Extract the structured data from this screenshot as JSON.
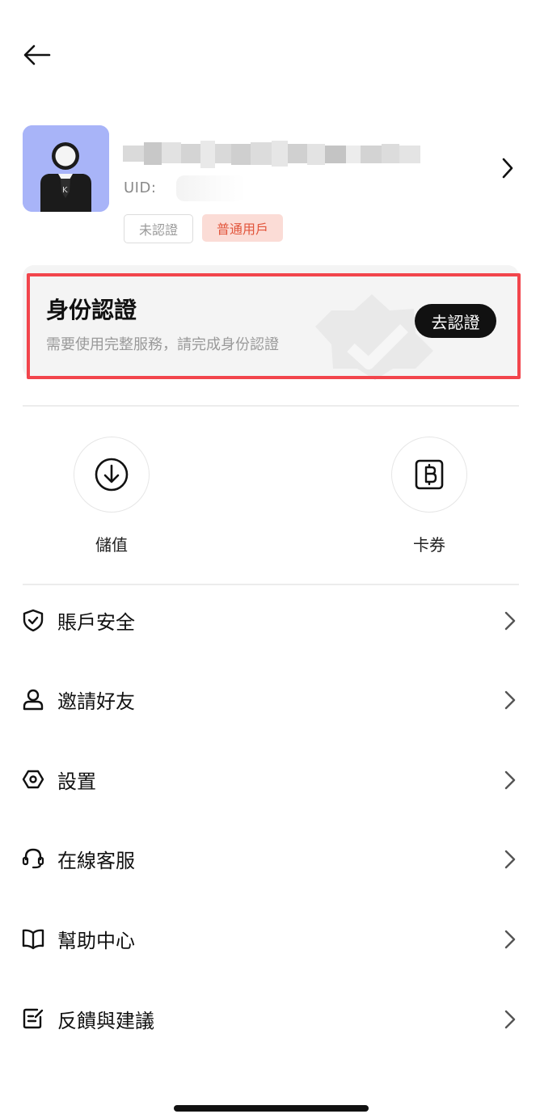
{
  "header": {
    "back_icon": "arrow-left-icon"
  },
  "profile": {
    "uid_label": "UID:",
    "avatar_letter": "K",
    "badges": {
      "unverified": "未認證",
      "user_level": "普通用戶"
    }
  },
  "verification": {
    "title": "身份認證",
    "subtitle": "需要使用完整服務，請完成身份認證",
    "button_label": "去認證"
  },
  "quick_actions": [
    {
      "label": "儲值",
      "icon": "deposit-download-icon"
    },
    {
      "label": "卡券",
      "icon": "coupon-bitcoin-icon"
    }
  ],
  "menu": [
    {
      "label": "賬戶安全",
      "icon": "shield-check-icon"
    },
    {
      "label": "邀請好友",
      "icon": "user-icon"
    },
    {
      "label": "設置",
      "icon": "hexagon-settings-icon"
    },
    {
      "label": "在線客服",
      "icon": "headset-icon"
    },
    {
      "label": "幫助中心",
      "icon": "book-icon"
    },
    {
      "label": "反饋與建議",
      "icon": "feedback-edit-icon"
    }
  ],
  "colors": {
    "accent_highlight": "#f2454c",
    "badge_user_bg": "#fbdcd6",
    "badge_user_text": "#e2553b",
    "avatar_bg": "#a8b4f8"
  }
}
